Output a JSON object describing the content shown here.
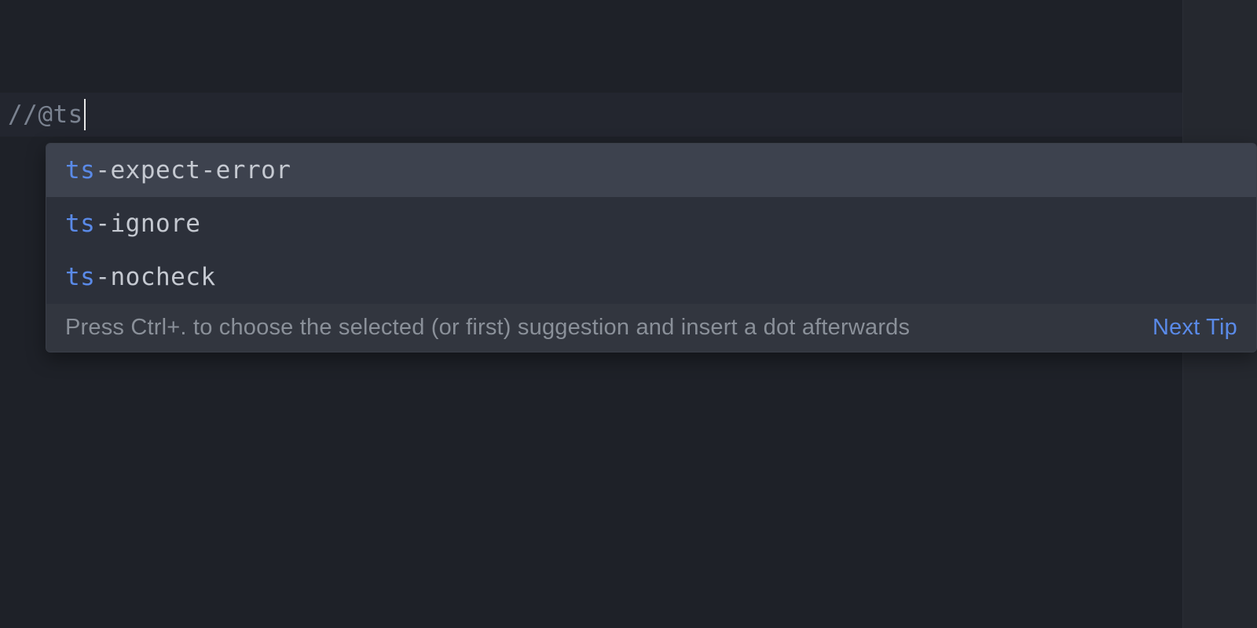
{
  "editor": {
    "code_line": "//@ts"
  },
  "completion": {
    "items": [
      {
        "match": "ts",
        "rest": "-expect-error",
        "selected": true
      },
      {
        "match": "ts",
        "rest": "-ignore",
        "selected": false
      },
      {
        "match": "ts",
        "rest": "-nocheck",
        "selected": false
      }
    ],
    "hint_text": "Press Ctrl+. to choose the selected (or first) suggestion and insert a dot afterwards",
    "next_tip_label": "Next Tip"
  }
}
